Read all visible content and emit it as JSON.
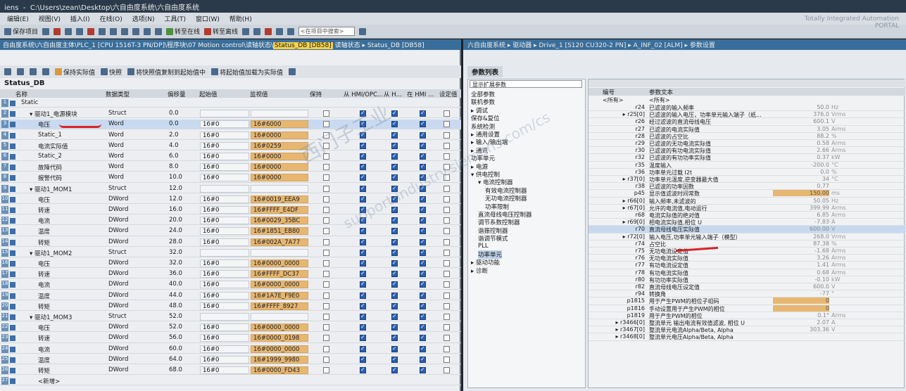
{
  "app": {
    "title": "C:\\Users\\zean\\Desktop\\六自由度系统\\六自由度系统",
    "title_prefix": "iens",
    "brand_line1": "Totally Integrated Automation",
    "brand_line2": "PORTAL"
  },
  "menu": [
    "编辑(E)",
    "视图(V)",
    "插入(I)",
    "在线(O)",
    "选项(N)",
    "工具(T)",
    "窗口(W)",
    "帮助(H)"
  ],
  "toolbar": {
    "save_label": "保存项目",
    "go_online": "转至在线",
    "go_offline": "转至离线",
    "search_placeholder": "<在项目中搜索>"
  },
  "left": {
    "path_prefix": "自由度系统\\六自由度主体\\PLC_1 [CPU 1516T-3 PN/DP]\\程序块\\07 Motion control\\读轴状态\\",
    "path_highlight": "Status_DB [DB58]",
    "path_suffix": " 读轴状态 ▸ Status_DB [DB58]",
    "tools": {
      "keep_actual": "保持实际值",
      "snapshot": "快照",
      "copy_snapshot": "将快照值复制到起始值中",
      "load_start": "将起始值加载为实际值"
    },
    "db_title": "Status_DB",
    "headers": [
      "名称",
      "数据类型",
      "偏移量",
      "起始值",
      "监视值",
      "保持",
      "从 HMI/OPC...",
      "从 H...",
      "在 HMI ...",
      "设定值"
    ],
    "rows": [
      {
        "n": "1",
        "name": "Static",
        "indent": 0,
        "type": "",
        "off": "",
        "start": "",
        "mon": "",
        "cb": false
      },
      {
        "n": "2",
        "name": "驱动1_电源模块",
        "indent": 1,
        "type": "Struct",
        "off": "0.0",
        "start": "",
        "mon": "",
        "cb": true
      },
      {
        "n": "3",
        "name": "电压",
        "indent": 2,
        "type": "Word",
        "off": "0.0",
        "start": "16#0",
        "mon": "16#6000",
        "cb": true
      },
      {
        "n": "4",
        "name": "Static_1",
        "indent": 2,
        "type": "Word",
        "off": "2.0",
        "start": "16#0",
        "mon": "16#0000",
        "cb": true
      },
      {
        "n": "5",
        "name": "电流实际值",
        "indent": 2,
        "type": "Word",
        "off": "4.0",
        "start": "16#0",
        "mon": "16#0259",
        "cb": true
      },
      {
        "n": "6",
        "name": "Static_2",
        "indent": 2,
        "type": "Word",
        "off": "6.0",
        "start": "16#0",
        "mon": "16#0000",
        "cb": true
      },
      {
        "n": "7",
        "name": "故障代码",
        "indent": 2,
        "type": "Word",
        "off": "8.0",
        "start": "16#0",
        "mon": "16#0000",
        "cb": true
      },
      {
        "n": "8",
        "name": "报警代码",
        "indent": 2,
        "type": "Word",
        "off": "10.0",
        "start": "16#0",
        "mon": "16#0000",
        "cb": true
      },
      {
        "n": "9",
        "name": "驱动1_MOM1",
        "indent": 1,
        "type": "Struct",
        "off": "12.0",
        "start": "",
        "mon": "",
        "cb": true
      },
      {
        "n": "10",
        "name": "电压",
        "indent": 2,
        "type": "DWord",
        "off": "12.0",
        "start": "16#0",
        "mon": "16#0019_EEA9",
        "cb": true
      },
      {
        "n": "11",
        "name": "转速",
        "indent": 2,
        "type": "DWord",
        "off": "16.0",
        "start": "16#0",
        "mon": "16#FFFF_E4DF",
        "cb": true
      },
      {
        "n": "12",
        "name": "电流",
        "indent": 2,
        "type": "DWord",
        "off": "20.0",
        "start": "16#0",
        "mon": "16#0029_35BC",
        "cb": true
      },
      {
        "n": "13",
        "name": "温度",
        "indent": 2,
        "type": "DWord",
        "off": "24.0",
        "start": "16#0",
        "mon": "16#1851_EB80",
        "cb": true
      },
      {
        "n": "14",
        "name": "转矩",
        "indent": 2,
        "type": "DWord",
        "off": "28.0",
        "start": "16#0",
        "mon": "16#002A_7A77",
        "cb": true
      },
      {
        "n": "15",
        "name": "驱动1_MOM2",
        "indent": 1,
        "type": "Struct",
        "off": "32.0",
        "start": "",
        "mon": "",
        "cb": true
      },
      {
        "n": "16",
        "name": "电压",
        "indent": 2,
        "type": "DWord",
        "off": "32.0",
        "start": "16#0",
        "mon": "16#0000_0000",
        "cb": true
      },
      {
        "n": "17",
        "name": "转速",
        "indent": 2,
        "type": "DWord",
        "off": "36.0",
        "start": "16#0",
        "mon": "16#FFFF_DC37",
        "cb": true
      },
      {
        "n": "18",
        "name": "电流",
        "indent": 2,
        "type": "DWord",
        "off": "40.0",
        "start": "16#0",
        "mon": "16#0000_0000",
        "cb": true
      },
      {
        "n": "19",
        "name": "温度",
        "indent": 2,
        "type": "DWord",
        "off": "44.0",
        "start": "16#0",
        "mon": "16#1A7E_F9E0",
        "cb": true
      },
      {
        "n": "20",
        "name": "转矩",
        "indent": 2,
        "type": "DWord",
        "off": "48.0",
        "start": "16#0",
        "mon": "16#FFFF_8927",
        "cb": true
      },
      {
        "n": "21",
        "name": "驱动1_MOM3",
        "indent": 1,
        "type": "Struct",
        "off": "52.0",
        "start": "",
        "mon": "",
        "cb": true
      },
      {
        "n": "22",
        "name": "电压",
        "indent": 2,
        "type": "DWord",
        "off": "52.0",
        "start": "16#0",
        "mon": "16#0000_0000",
        "cb": true
      },
      {
        "n": "23",
        "name": "转速",
        "indent": 2,
        "type": "DWord",
        "off": "56.0",
        "start": "16#0",
        "mon": "16#0000_0198",
        "cb": true
      },
      {
        "n": "24",
        "name": "电流",
        "indent": 2,
        "type": "DWord",
        "off": "60.0",
        "start": "16#0",
        "mon": "16#0000_0000",
        "cb": true
      },
      {
        "n": "25",
        "name": "温度",
        "indent": 2,
        "type": "DWord",
        "off": "64.0",
        "start": "16#0",
        "mon": "16#1999_9980",
        "cb": true
      },
      {
        "n": "26",
        "name": "转矩",
        "indent": 2,
        "type": "DWord",
        "off": "68.0",
        "start": "16#0",
        "mon": "16#0000_FD43",
        "cb": true
      },
      {
        "n": "27",
        "name": "<新增>",
        "indent": 2,
        "type": "",
        "off": "",
        "start": "",
        "mon": "",
        "cb": false
      }
    ]
  },
  "right": {
    "path": "六自由度系统 ▸ 驱动器 ▸ Drive_1 [S120 CU320-2 PN] ▸ A_INF_02 [ALM] ▸ 参数设置",
    "tab": "参数列表",
    "filter": "显示扩展参数",
    "tree": [
      {
        "t": "全部参数",
        "l": 0
      },
      {
        "t": "联机参数",
        "l": 0
      },
      {
        "t": "▸ 调试",
        "l": 0
      },
      {
        "t": "保存&复位",
        "l": 0
      },
      {
        "t": "系统检测",
        "l": 0
      },
      {
        "t": "▸ 通用设置",
        "l": 0
      },
      {
        "t": "▸ 输入/输出端",
        "l": 0
      },
      {
        "t": "▸ 通讯",
        "l": 0
      },
      {
        "t": "功率单元",
        "l": 0
      },
      {
        "t": "▸ 电源",
        "l": 0
      },
      {
        "t": "▾ 供电控制",
        "l": 0
      },
      {
        "t": "▾ 电流控制器",
        "l": 1
      },
      {
        "t": "有效电流控制器",
        "l": 2
      },
      {
        "t": "无功电流控制器",
        "l": 2
      },
      {
        "t": "功率限制",
        "l": 2
      },
      {
        "t": "直流母线电压控制器",
        "l": 1
      },
      {
        "t": "调节系数控制器",
        "l": 1
      },
      {
        "t": "谐振控制器",
        "l": 1
      },
      {
        "t": "谐调节模式",
        "l": 1
      },
      {
        "t": "PLL",
        "l": 1
      },
      {
        "t": "功率单元",
        "l": 1
      },
      {
        "t": "▸ 驱动功能",
        "l": 0
      },
      {
        "t": "▸ 诊断",
        "l": 0
      }
    ],
    "param_headers": [
      "编号",
      "参数文本"
    ],
    "param_filter": "<所有>",
    "params": [
      {
        "num": "r24",
        "txt": "已滤波的输入频率",
        "val": "50.0",
        "unit": "Hz",
        "hl": false
      },
      {
        "num": "▸ r25[0]",
        "txt": "已滤波的输入电压，功率单元输入端子（纸...",
        "val": "376.0",
        "unit": "Vrms",
        "hl": false
      },
      {
        "num": "r26",
        "txt": "经过滤波的直流母线电压",
        "val": "600.1",
        "unit": "V",
        "hl": false
      },
      {
        "num": "r27",
        "txt": "已滤波的电流实际值",
        "val": "3.05",
        "unit": "Arms",
        "hl": false
      },
      {
        "num": "r28",
        "txt": "已滤波的占空比",
        "val": "88.2",
        "unit": "%",
        "hl": false
      },
      {
        "num": "r29",
        "txt": "已滤波的无功电流实际值",
        "val": "0.58",
        "unit": "Arms",
        "hl": false
      },
      {
        "num": "r30",
        "txt": "已滤波的有功电流实际值",
        "val": "2.66",
        "unit": "Arms",
        "hl": false
      },
      {
        "num": "r32",
        "txt": "已滤波的有功功率实际值",
        "val": "0.37",
        "unit": "kW",
        "hl": false
      },
      {
        "num": "r35",
        "txt": "温度输入",
        "val": "-200.0",
        "unit": "°C",
        "hl": false
      },
      {
        "num": "r36",
        "txt": "功率单元过载 I2t",
        "val": "0.0",
        "unit": "%",
        "hl": false
      },
      {
        "num": "▸ r37[0]",
        "txt": "功率单元温度,逆变器最大值",
        "val": "34",
        "unit": "°C",
        "hl": false
      },
      {
        "num": "r38",
        "txt": "已滤波的功率因数",
        "val": "0.77",
        "unit": "",
        "hl": false
      },
      {
        "num": "p45",
        "txt": "显示值滤波时间常数",
        "val": "150.00",
        "unit": "ms",
        "hl": true
      },
      {
        "num": "▸ r66[0]",
        "txt": "输入频率,未滤波的",
        "val": "50.05",
        "unit": "Hz",
        "hl": false
      },
      {
        "num": "▸ r67[0]",
        "txt": "允许的电流值,电动运行",
        "val": "399.99",
        "unit": "Arms",
        "hl": false
      },
      {
        "num": "r68",
        "txt": "电流实际值的绝对值",
        "val": "6.85",
        "unit": "Arms",
        "hl": false
      },
      {
        "num": "▸ r69[0]",
        "txt": "相电流实际值,相位 U",
        "val": "-7.83",
        "unit": "A",
        "hl": false
      },
      {
        "num": "r70",
        "txt": "直流母线电压实际值",
        "val": "600.00",
        "unit": "V",
        "hl": false
      },
      {
        "num": "▸ r72[0]",
        "txt": "输入电压,功率单元输入端子（模型）",
        "val": "268.0",
        "unit": "Vrms",
        "hl": false
      },
      {
        "num": "r74",
        "txt": "占空比",
        "val": "87.38",
        "unit": "%",
        "hl": false
      },
      {
        "num": "r75",
        "txt": "无功电流设定值",
        "val": "-1.68",
        "unit": "Arms",
        "hl": false
      },
      {
        "num": "r76",
        "txt": "无功电流实际值",
        "val": "3.26",
        "unit": "Arms",
        "hl": false
      },
      {
        "num": "r77",
        "txt": "有功电流设定值",
        "val": "1.41",
        "unit": "Arms",
        "hl": false
      },
      {
        "num": "r78",
        "txt": "有功电流实际值",
        "val": "0.68",
        "unit": "Arms",
        "hl": false
      },
      {
        "num": "r80",
        "txt": "有功功率实际值",
        "val": "-0.10",
        "unit": "kW",
        "hl": false
      },
      {
        "num": "r82",
        "txt": "直流母线电压设定值",
        "val": "600.0",
        "unit": "V",
        "hl": false
      },
      {
        "num": "r94",
        "txt": "转换角",
        "val": "-77",
        "unit": "°",
        "hl": false
      },
      {
        "num": "p1815",
        "txt": "用于产生PWM的相位子组码",
        "val": "0",
        "unit": "",
        "hl": true
      },
      {
        "num": "p1816",
        "txt": "手动设置用于产生PWM的相位",
        "val": "0",
        "unit": "",
        "hl": true
      },
      {
        "num": "p1819",
        "txt": "用于产生PWM的相位",
        "val": "0.1°",
        "unit": "Arms",
        "hl": false
      },
      {
        "num": "▸ r3466[0]",
        "txt": "整流单元 输出电流有效值滤波, 相位 U",
        "val": "2.07",
        "unit": "A",
        "hl": false
      },
      {
        "num": "▸ r3467[0]",
        "txt": "整流单元电流Alpha/Beta, Alpha",
        "val": "303.36",
        "unit": "V",
        "hl": false
      },
      {
        "num": "▸ r3468[0]",
        "txt": "整流单元电压Alpha/Beta, Alpha",
        "val": "",
        "unit": "",
        "hl": false
      }
    ]
  },
  "watermark": {
    "line1": "西门子工业",
    "line2": "support.industry.siemens.com/cs"
  },
  "colors": {
    "accent": "#3a6e9a",
    "monitor": "#e7b771",
    "checkbox_on": "#2b5fb0",
    "annotation": "#d8232a"
  }
}
